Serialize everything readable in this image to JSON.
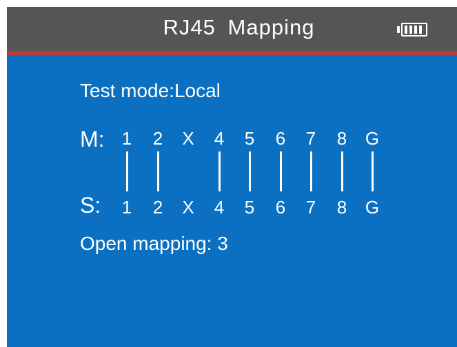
{
  "header": {
    "title": "RJ45 Mapping",
    "battery_icon": "battery-full-icon"
  },
  "test_mode": "Test mode:Local",
  "mapping": {
    "master_label": "M:",
    "slave_label": "S:",
    "pins": [
      {
        "m": "1",
        "s": "1",
        "connected": true
      },
      {
        "m": "2",
        "s": "2",
        "connected": true
      },
      {
        "m": "X",
        "s": "X",
        "connected": false
      },
      {
        "m": "4",
        "s": "4",
        "connected": true
      },
      {
        "m": "5",
        "s": "5",
        "connected": true
      },
      {
        "m": "6",
        "s": "6",
        "connected": true
      },
      {
        "m": "7",
        "s": "7",
        "connected": true
      },
      {
        "m": "8",
        "s": "8",
        "connected": true
      },
      {
        "m": "G",
        "s": "G",
        "connected": true
      }
    ]
  },
  "open_mapping": "Open mapping: 3",
  "colors": {
    "screen_background": "#0b70c1",
    "header_background": "#555555",
    "header_accent": "#c0383a",
    "text": "#ffffff"
  }
}
